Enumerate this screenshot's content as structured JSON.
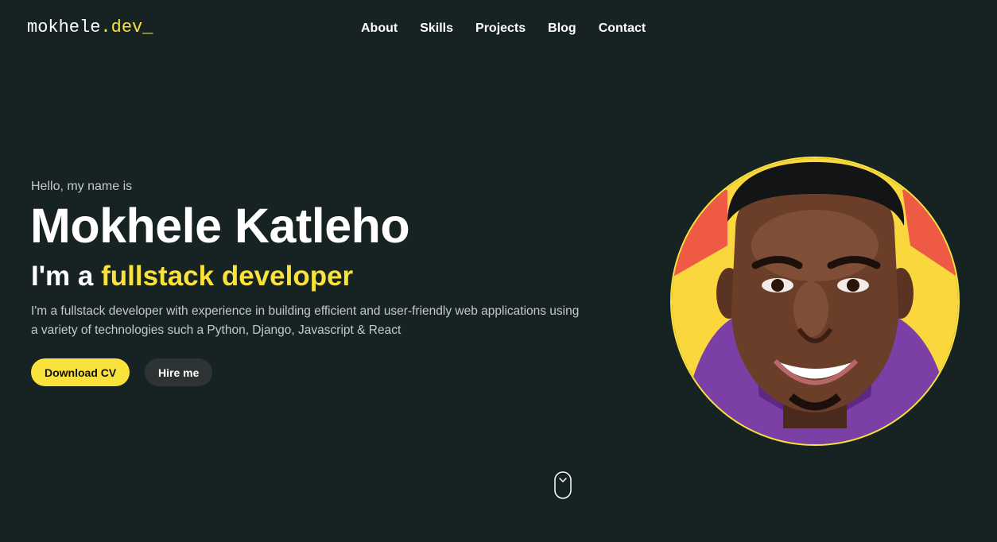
{
  "header": {
    "logo_name": "mokhele",
    "logo_ext": ".dev",
    "logo_cursor": "_",
    "nav": [
      {
        "label": "About"
      },
      {
        "label": "Skills"
      },
      {
        "label": "Projects"
      },
      {
        "label": "Blog"
      },
      {
        "label": "Contact"
      }
    ]
  },
  "hero": {
    "greeting": "Hello, my name is",
    "name": "Mokhele Katleho",
    "role_prefix": "I'm a ",
    "role_highlight": "fullstack developer",
    "bio": "I'm a fullstack developer with experience in building efficient and user-friendly web applications using a variety of technologies such a Python, Django, Javascript & React",
    "download_cv_label": "Download CV",
    "hire_me_label": "Hire me"
  },
  "avatar": {
    "icon": "profile-portrait"
  },
  "scroll_indicator": {
    "icon": "mouse-scroll-icon"
  },
  "colors": {
    "background": "#172222",
    "accent": "#f9e23b",
    "secondary_button": "#2e3434",
    "muted_text": "#c6c9c9"
  }
}
